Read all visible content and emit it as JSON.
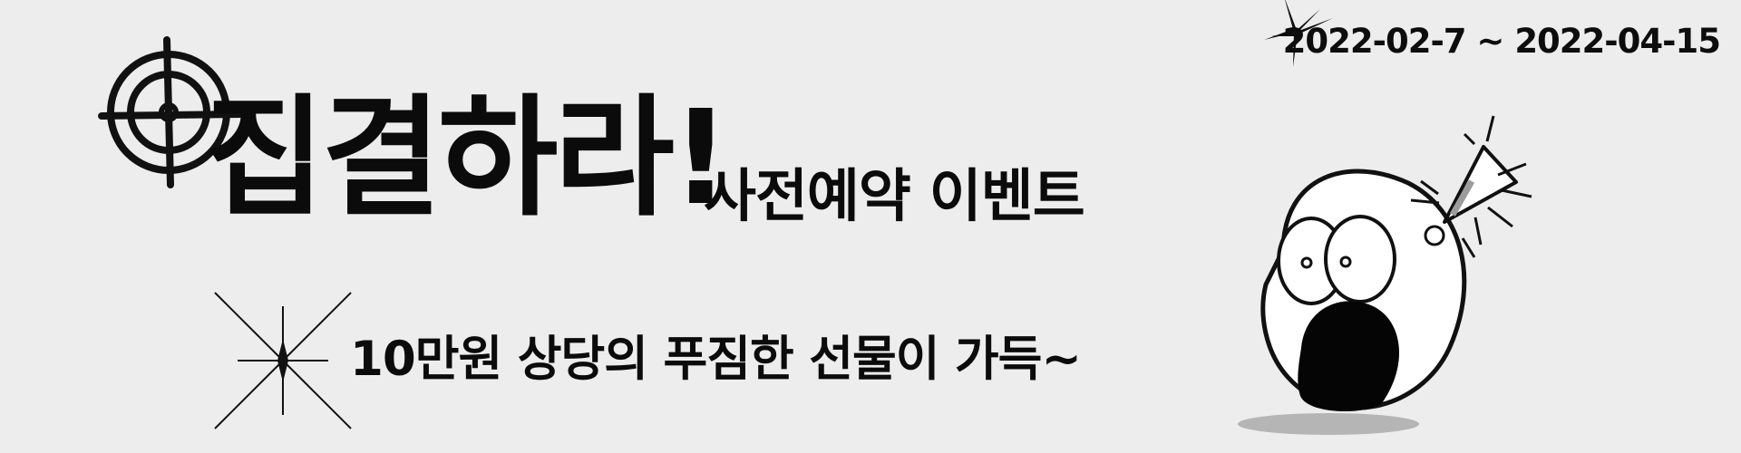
{
  "banner": {
    "date_range": "2022-02-7 ~ 2022-04-15",
    "title": "집결하라!",
    "subtitle": "사전예약 이벤트",
    "gift_text": "10만원 상당의 푸짐한 선물이 가득~",
    "icons": {
      "target": "target-icon",
      "sparkle": "sparkle-icon",
      "mascot": "surprised-face-icon",
      "megaphone": "megaphone-icon"
    },
    "colors": {
      "background": "#ededed",
      "text": "#0b0b0b",
      "shadow": "#9c9c9c"
    }
  }
}
